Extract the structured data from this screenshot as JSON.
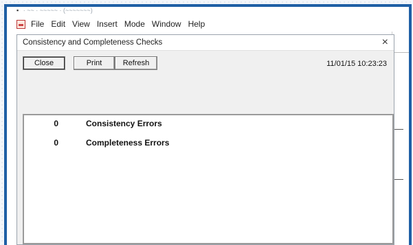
{
  "window": {
    "title_fragment": "· ~~ · ~~~~~ · (~~~~~~~)"
  },
  "menubar": {
    "items": [
      "File",
      "Edit",
      "View",
      "Insert",
      "Mode",
      "Window",
      "Help"
    ]
  },
  "dialog": {
    "title": "Consistency and Completeness Checks",
    "close_glyph": "×",
    "buttons": {
      "close": "Close",
      "print": "Print",
      "refresh": "Refresh"
    },
    "timestamp": "11/01/15 10:23:23",
    "results": [
      {
        "count": "0",
        "label": "Consistency Errors"
      },
      {
        "count": "0",
        "label": "Completeness Errors"
      }
    ]
  },
  "colors": {
    "frame_border": "#1f5fa5",
    "dialog_background": "#f0f0f0"
  }
}
